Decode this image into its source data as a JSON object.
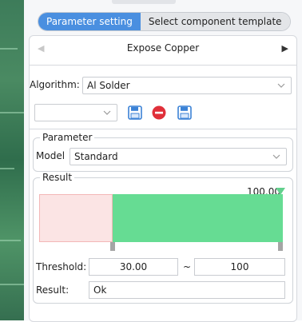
{
  "tabs": [
    {
      "label": "Parameter setting",
      "active": true
    },
    {
      "label": "Select component template",
      "active": false
    }
  ],
  "nav": {
    "title": "Expose Copper"
  },
  "algorithm": {
    "label": "Algorithm:",
    "value": "Al Solder"
  },
  "template_select": {
    "value": ""
  },
  "icons": [
    "save-icon",
    "delete-icon",
    "save-as-icon"
  ],
  "parameter_group": {
    "legend": "Parameter",
    "model_label": "Model",
    "model_value": "Standard"
  },
  "result_group": {
    "legend": "Result",
    "max_value": "100.00",
    "range_fill_start_pct": 30,
    "threshold_label": "Threshold:",
    "threshold_min": "30.00",
    "separator": "~",
    "threshold_max": "100",
    "result_label": "Result:",
    "result_value": "Ok"
  },
  "colors": {
    "accent": "#4a8fe0",
    "pass_fill": "#66dc93",
    "fail_fill": "#fbe4e4",
    "delete_icon": "#e0303a",
    "save_icon": "#3b82d6"
  }
}
